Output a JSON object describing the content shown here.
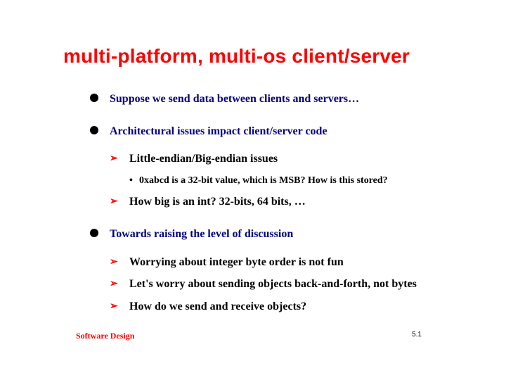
{
  "title": "multi-platform, multi-os client/server",
  "bullets": [
    {
      "text": "Suppose we send data between clients and servers…",
      "children": []
    },
    {
      "text": "Architectural issues impact client/server code",
      "children": [
        {
          "text": "Little-endian/Big-endian issues",
          "children": [
            {
              "text": "0xabcd is a 32-bit value, which is MSB? How is this stored?"
            }
          ]
        },
        {
          "text": "How big is an int? 32-bits, 64 bits, …",
          "children": []
        }
      ]
    },
    {
      "text": "Towards raising the level of discussion",
      "children": [
        {
          "text": "Worrying about integer byte order is not fun",
          "children": []
        },
        {
          "text": "Let's worry about sending objects back-and-forth, not bytes",
          "children": []
        },
        {
          "text": "How do we send and receive objects?",
          "children": []
        }
      ]
    }
  ],
  "footer": {
    "left": "Software Design",
    "right": "5.1"
  }
}
